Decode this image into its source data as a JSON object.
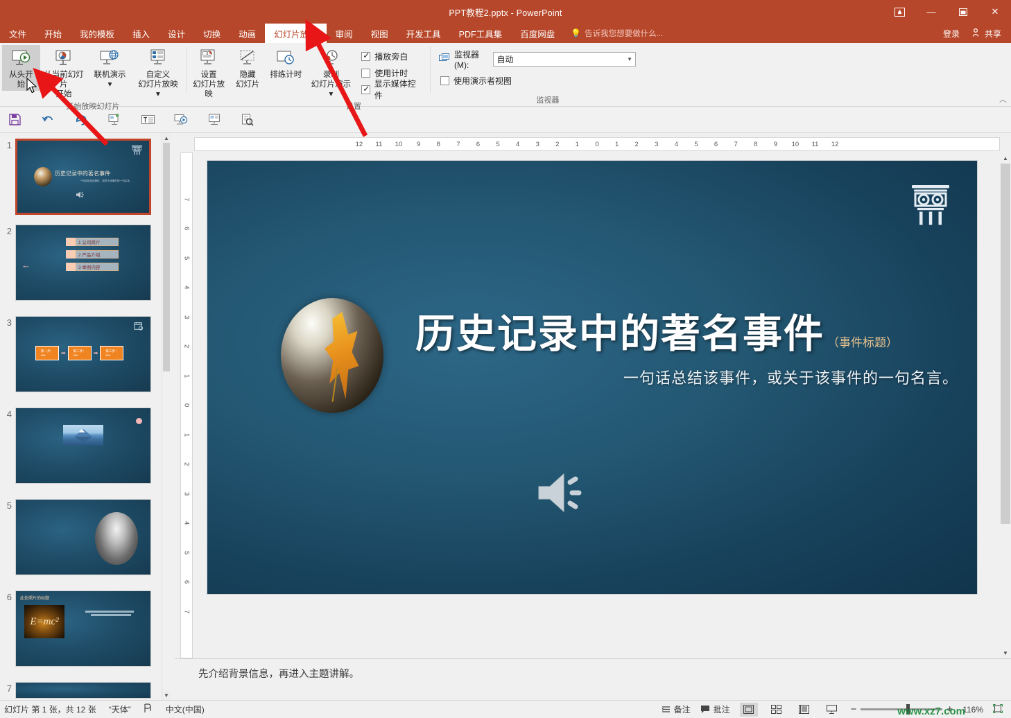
{
  "window": {
    "title": "PPT教程2.pptx - PowerPoint",
    "ribbon_display_icon": "ribbon-display-options-icon",
    "minimize": "—",
    "maximize": "▫",
    "close": "✕"
  },
  "tabs": [
    {
      "label": "文件",
      "active": false
    },
    {
      "label": "开始",
      "active": false
    },
    {
      "label": "我的模板",
      "active": false
    },
    {
      "label": "插入",
      "active": false
    },
    {
      "label": "设计",
      "active": false
    },
    {
      "label": "切换",
      "active": false
    },
    {
      "label": "动画",
      "active": false
    },
    {
      "label": "幻灯片放映",
      "active": true
    },
    {
      "label": "审阅",
      "active": false
    },
    {
      "label": "视图",
      "active": false
    },
    {
      "label": "开发工具",
      "active": false
    },
    {
      "label": "PDF工具集",
      "active": false
    },
    {
      "label": "百度网盘",
      "active": false
    }
  ],
  "tellme": {
    "placeholder": "告诉我您想要做什么...",
    "icon": "lightbulb-icon"
  },
  "account": {
    "signin": "登录",
    "share": "共享",
    "share_icon": "person-share-icon"
  },
  "ribbon": {
    "groups": [
      {
        "name": "开始放映幻灯片",
        "label": "开始放映幻灯片",
        "buttons": [
          {
            "label": "从头开始",
            "icon": "start-from-beginning-icon",
            "pressed": true
          },
          {
            "label": "从当前幻灯片\n开始",
            "icon": "start-from-current-icon",
            "pressed": false
          },
          {
            "label": "联机演示\n▾",
            "icon": "present-online-icon",
            "pressed": false
          },
          {
            "label": "自定义\n幻灯片放映 ▾",
            "icon": "custom-slideshow-icon",
            "pressed": false
          }
        ]
      },
      {
        "name": "设置",
        "label": "设置",
        "buttons": [
          {
            "label": "设置\n幻灯片放映",
            "icon": "setup-slideshow-icon",
            "pressed": false
          },
          {
            "label": "隐藏\n幻灯片",
            "icon": "hide-slide-icon",
            "pressed": false
          },
          {
            "label": "排练计时",
            "icon": "rehearse-timings-icon",
            "pressed": false
          },
          {
            "label": "录制\n幻灯片演示 ▾",
            "icon": "record-slideshow-icon",
            "pressed": false
          }
        ],
        "checkboxes": [
          {
            "label": "播放旁白",
            "checked": true
          },
          {
            "label": "使用计时",
            "checked": false
          },
          {
            "label": "显示媒体控件",
            "checked": true
          }
        ]
      },
      {
        "name": "监视器",
        "label": "监视器",
        "monitor_label": "监视器(M):",
        "monitor_icon": "monitor-icon",
        "monitor_value": "自动",
        "presenter_view": {
          "label": "使用演示者视图",
          "checked": false
        }
      }
    ],
    "collapse_icon": "collapse-ribbon-icon"
  },
  "quick_toolbar": [
    {
      "name": "save-icon",
      "glyph": "💾"
    },
    {
      "name": "undo-icon",
      "glyph": "↺"
    },
    {
      "name": "redo-icon",
      "glyph": "↻"
    },
    {
      "name": "start-presentation-icon",
      "glyph": "▣"
    },
    {
      "name": "text-box-icon",
      "glyph": "▤"
    },
    {
      "name": "slideshow-from-beginning-icon",
      "glyph": "▷"
    },
    {
      "name": "slide-icon",
      "glyph": "▥"
    },
    {
      "name": "print-preview-icon",
      "glyph": "🔍"
    }
  ],
  "ruler": {
    "horizontal": [
      "12",
      "11",
      "10",
      "9",
      "8",
      "7",
      "6",
      "5",
      "4",
      "3",
      "2",
      "1",
      "0",
      "1",
      "2",
      "3",
      "4",
      "5",
      "6",
      "7",
      "8",
      "9",
      "10",
      "11",
      "12"
    ],
    "vertical": [
      "7",
      "6",
      "5",
      "4",
      "3",
      "2",
      "1",
      "0",
      "1",
      "2",
      "3",
      "4",
      "5",
      "6",
      "7"
    ]
  },
  "slides": [
    {
      "num": "1",
      "selected": true,
      "kind": "title",
      "title": "历史记录中的著名事件",
      "sub": "（事件标题）",
      "caption": "一句话总结该事件，或关于该事件的一句名言。",
      "icons": [
        "ionic-column-icon",
        "speaker-icon"
      ]
    },
    {
      "num": "2",
      "selected": false,
      "kind": "list",
      "items": [
        "1 公司简介",
        "2 产品介绍",
        "3 举例内容"
      ]
    },
    {
      "num": "3",
      "selected": false,
      "kind": "steps",
      "items": [
        "第一步：\nxxx",
        "第二步：\nxxx",
        "第三步：\nxxx"
      ]
    },
    {
      "num": "4",
      "selected": false,
      "kind": "photo"
    },
    {
      "num": "5",
      "selected": false,
      "kind": "portrait"
    },
    {
      "num": "6",
      "selected": false,
      "kind": "formula",
      "title": "此处照片的标题",
      "formula": "E=mc²"
    },
    {
      "num": "7",
      "selected": false,
      "kind": "partial"
    }
  ],
  "current_slide": {
    "title": "历史记录中的著名事件",
    "title_suffix": "（事件标题）",
    "caption": "一句话总结该事件，或关于该事件的一句名言。",
    "column_icon": "ionic-column-icon",
    "speaker_icon": "speaker-icon"
  },
  "notes": {
    "text": "先介绍背景信息，再进入主题讲解。"
  },
  "status": {
    "slide_info": "幻灯片 第 1 张，共 12 张",
    "theme": "“天体”",
    "accessibility_icon": "accessibility-icon",
    "language": "中文(中国)",
    "notes_btn": "备注",
    "comments_btn": "批注",
    "views": [
      {
        "name": "normal-view",
        "glyph": "▣",
        "active": true
      },
      {
        "name": "slide-sorter-view",
        "glyph": "▦",
        "active": false
      },
      {
        "name": "reading-view",
        "glyph": "▤",
        "active": false
      },
      {
        "name": "slideshow-view",
        "glyph": "▽",
        "active": false
      }
    ],
    "zoom_out": "−",
    "zoom_in": "+",
    "zoom_level": "116%",
    "fit_icon": "fit-slide-icon",
    "watermark": "www.xz7.com"
  },
  "colors": {
    "brand": "#b7472a",
    "slide_blue": "#1f4d68",
    "accent_orange": "#ef8420",
    "arrow_red": "#e81616",
    "selection": "#c0452a"
  }
}
